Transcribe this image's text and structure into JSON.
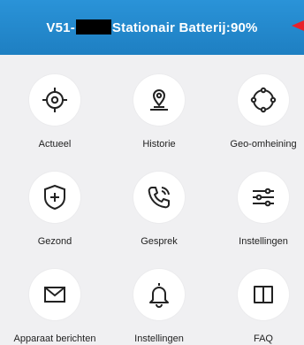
{
  "header": {
    "title_prefix": "V51-",
    "title_suffix": "Stationair Batterij:90%",
    "accent_color": "#2a93d8",
    "arrow_color": "#e8202a"
  },
  "menu": {
    "items": [
      {
        "label": "Actueel",
        "icon": "crosshair-icon"
      },
      {
        "label": "Historie",
        "icon": "location-pin-icon"
      },
      {
        "label": "Geo-omheining",
        "icon": "geofence-icon"
      },
      {
        "label": "Gezond",
        "icon": "shield-plus-icon"
      },
      {
        "label": "Gesprek",
        "icon": "phone-icon"
      },
      {
        "label": "Instellingen",
        "icon": "sliders-icon"
      },
      {
        "label": "Apparaat berichten",
        "icon": "envelope-icon"
      },
      {
        "label": "Instellingen",
        "icon": "bell-icon"
      },
      {
        "label": "FAQ",
        "icon": "book-icon"
      }
    ]
  }
}
